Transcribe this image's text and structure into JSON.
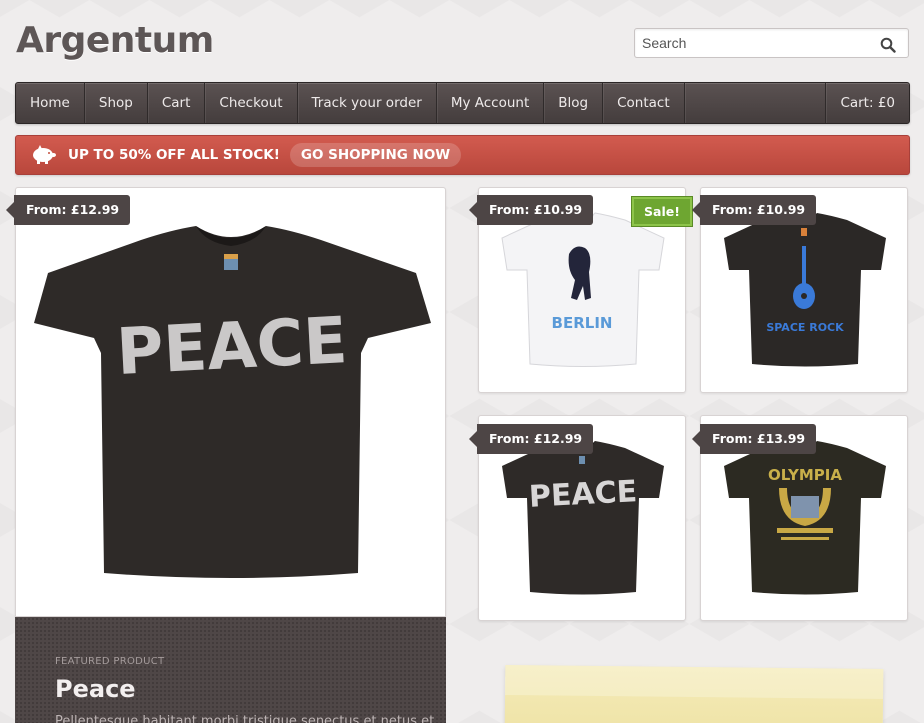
{
  "site": {
    "logo": "Argentum"
  },
  "search": {
    "placeholder": "Search"
  },
  "nav": {
    "items": [
      {
        "label": "Home"
      },
      {
        "label": "Shop"
      },
      {
        "label": "Cart"
      },
      {
        "label": "Checkout"
      },
      {
        "label": "Track your order"
      },
      {
        "label": "My Account"
      },
      {
        "label": "Blog"
      },
      {
        "label": "Contact"
      }
    ],
    "cart": "Cart: £0"
  },
  "promo": {
    "text": "UP TO 50% OFF ALL STOCK!",
    "button": "GO SHOPPING NOW",
    "icon": "piggy-bank-icon"
  },
  "featured": {
    "price": "From: £12.99",
    "label": "FEATURED PRODUCT",
    "title": "Peace",
    "description": "Pellentesque habitant morbi tristique senectus et netus et"
  },
  "products": [
    {
      "price": "From: £10.99",
      "sale": "Sale!",
      "print": "BERLIN",
      "shirt_color": "#f4f4f6"
    },
    {
      "price": "From: £10.99",
      "print": "SPACE ROCK",
      "shirt_color": "#2b2826"
    },
    {
      "price": "From: £12.99",
      "print": "PEACE",
      "shirt_color": "#2e2a28"
    },
    {
      "price": "From: £13.99",
      "print": "OLYMPIA",
      "shirt_color": "#2c2a22"
    }
  ],
  "colors": {
    "nav": "#4d4545",
    "promo": "#c4503f",
    "sale": "#6ea631",
    "price_tag": "#4d4545"
  }
}
